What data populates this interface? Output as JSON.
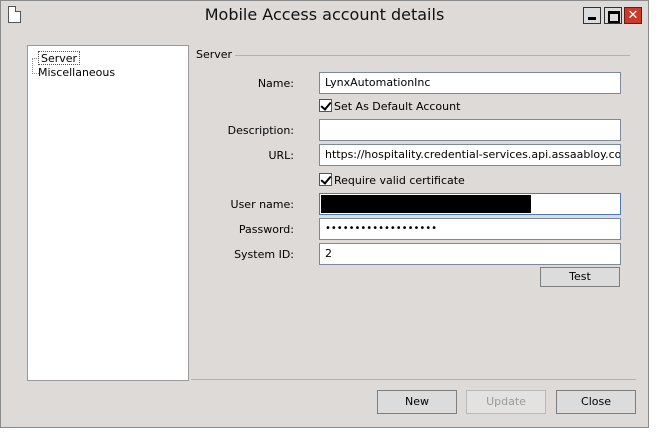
{
  "window": {
    "title": "Mobile Access account details",
    "close_glyph": "✕"
  },
  "tree": {
    "items": [
      {
        "label": "Server",
        "selected": true
      },
      {
        "label": "Miscellaneous",
        "selected": false
      }
    ]
  },
  "section": {
    "title": "Server"
  },
  "form": {
    "name_label": "Name:",
    "name_value": "LynxAutomationInc",
    "default_account_label": "Set As Default Account",
    "default_account_checked": true,
    "description_label": "Description:",
    "description_value": "",
    "url_label": "URL:",
    "url_value": "https://hospitality.credential-services.api.assaabloy.com",
    "require_cert_label": "Require valid certificate",
    "require_cert_checked": true,
    "username_label": "User name:",
    "username_value": "",
    "password_label": "Password:",
    "password_value": "•••••••••••••••••••",
    "systemid_label": "System ID:",
    "systemid_value": "2",
    "test_label": "Test"
  },
  "footer": {
    "new_label": "New",
    "update_label": "Update",
    "close_label": "Close"
  },
  "icons": {
    "window_icon": "document-icon",
    "minimize": "minimize-icon",
    "maximize": "maximize-icon",
    "close": "close-icon"
  },
  "colors": {
    "window_bg": "#dedad7",
    "close_button": "#c83a2a",
    "field_border_focus": "#4a7ab8"
  }
}
